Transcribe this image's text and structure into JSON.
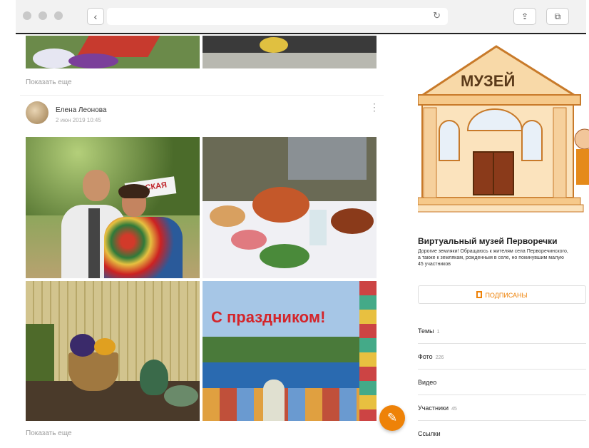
{
  "browser": {
    "back_glyph": "‹",
    "reload_glyph": "↻",
    "share_glyph": "⇪",
    "tabs_glyph": "⧉"
  },
  "feed": {
    "show_more_1": "Показать еще",
    "post": {
      "author": "Елена Леонова",
      "date": "2 июн 2019 10:45",
      "kebab": "⋮",
      "banner_text": "С праздником!",
      "sign_text": "ЬСКАЯ"
    },
    "show_more_2": "Показать еще"
  },
  "fab": {
    "glyph": "✎"
  },
  "group": {
    "building_sign": "МУЗЕЙ",
    "title": "Виртуальный музей Перворечки",
    "desc_line1": "Дорогие земляки! Обращаюсь к жителям села Перворечинского,",
    "desc_line2": "а также к землякам, рожденным в селе, но покинувшим малую",
    "members": "45 участников",
    "subscribe_label": "ПОДПИСАНЫ",
    "menu": [
      {
        "label": "Темы",
        "count": "1"
      },
      {
        "label": "Фото",
        "count": "226"
      },
      {
        "label": "Видео",
        "count": ""
      },
      {
        "label": "Участники",
        "count": "45"
      },
      {
        "label": "Ссылки",
        "count": ""
      }
    ]
  },
  "colors": {
    "accent": "#ee8208",
    "museum_fill": "#f8d9a8",
    "museum_stroke": "#c87a2a"
  }
}
